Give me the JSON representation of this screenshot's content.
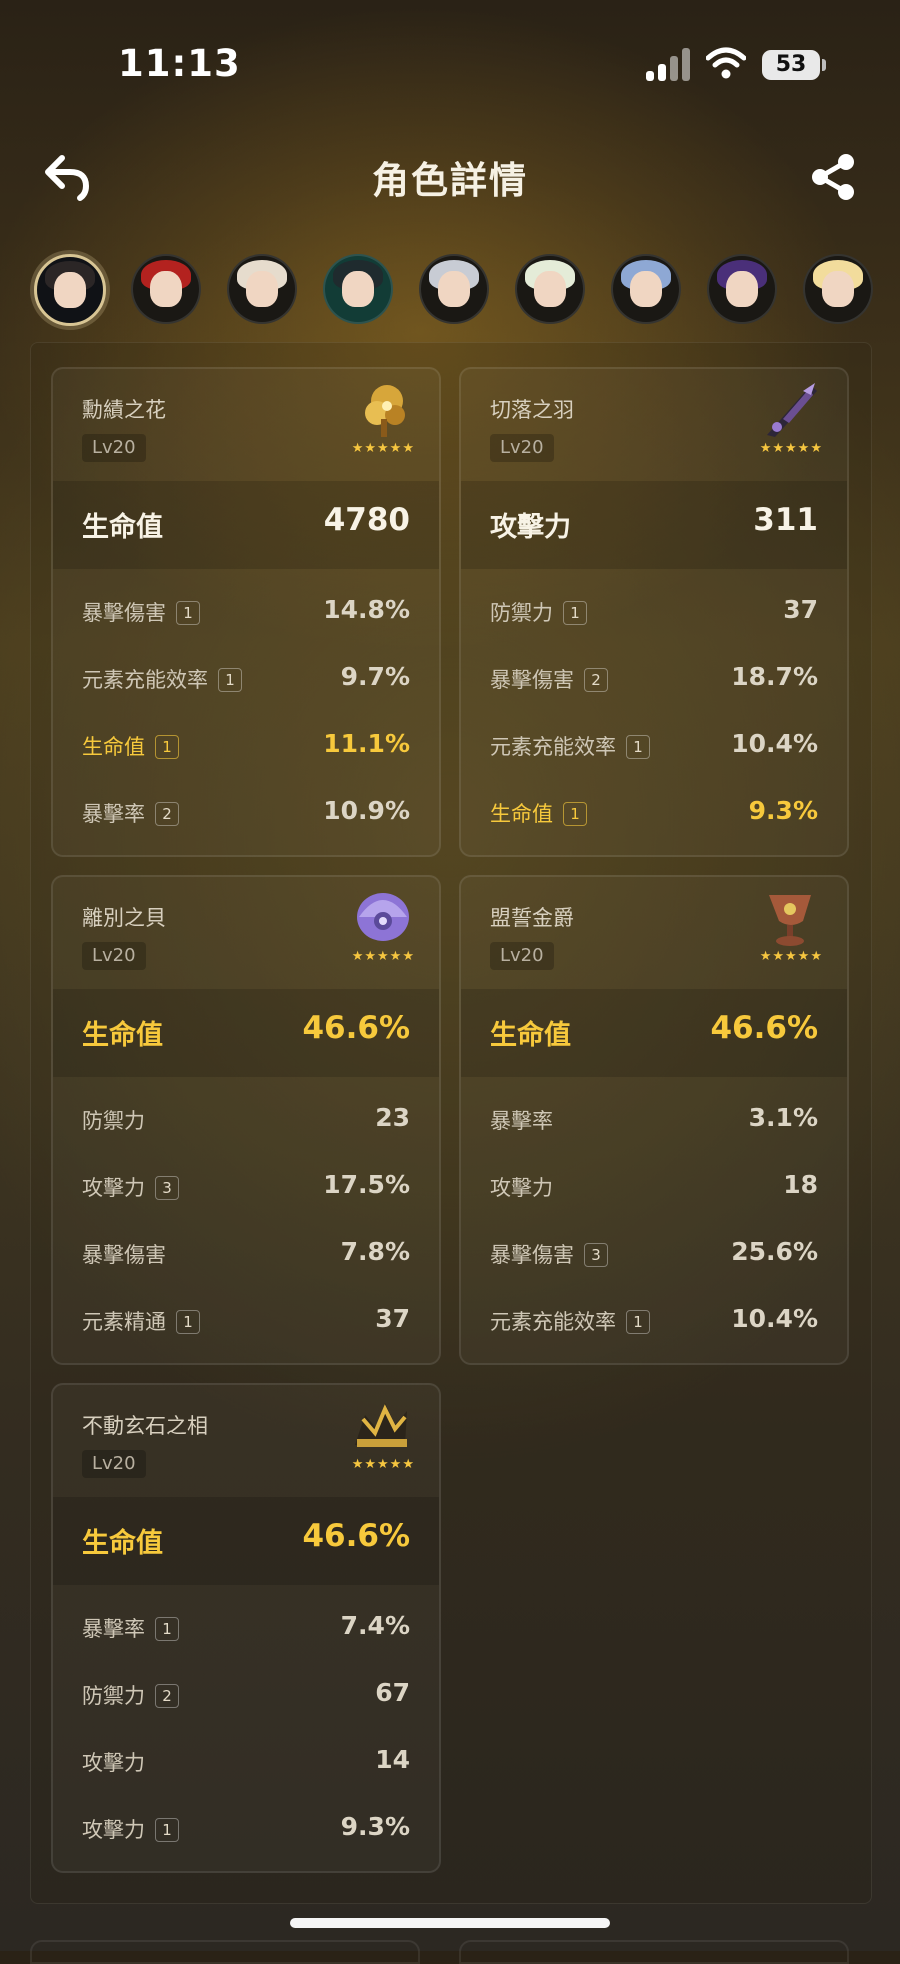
{
  "status": {
    "time": "11:13",
    "battery": "53"
  },
  "header": {
    "title": "角色詳情"
  },
  "colors": {
    "accent_gold": "#f7c93c",
    "star": "#f6c640"
  },
  "icons": [
    "back-arrow-icon",
    "share-icon",
    "signal-icon",
    "wifi-icon",
    "battery-icon"
  ],
  "avatars": [
    {
      "name": "character-1",
      "active": true
    },
    {
      "name": "character-2"
    },
    {
      "name": "character-3"
    },
    {
      "name": "character-4"
    },
    {
      "name": "character-5"
    },
    {
      "name": "character-6"
    },
    {
      "name": "character-7"
    },
    {
      "name": "character-8"
    },
    {
      "name": "character-9"
    }
  ],
  "artifacts": [
    {
      "name": "勳績之花",
      "level": "Lv20",
      "stars": "★★★★★",
      "main": {
        "label": "生命值",
        "value": "4780",
        "highlight": false
      },
      "subs": [
        {
          "label": "暴擊傷害",
          "rolls": "1",
          "value": "14.8%",
          "highlight": false
        },
        {
          "label": "元素充能效率",
          "rolls": "1",
          "value": "9.7%",
          "highlight": false
        },
        {
          "label": "生命值",
          "rolls": "1",
          "value": "11.1%",
          "highlight": true
        },
        {
          "label": "暴擊率",
          "rolls": "2",
          "value": "10.9%",
          "highlight": false
        }
      ]
    },
    {
      "name": "切落之羽",
      "level": "Lv20",
      "stars": "★★★★★",
      "main": {
        "label": "攻擊力",
        "value": "311",
        "highlight": false
      },
      "subs": [
        {
          "label": "防禦力",
          "rolls": "1",
          "value": "37",
          "highlight": false
        },
        {
          "label": "暴擊傷害",
          "rolls": "2",
          "value": "18.7%",
          "highlight": false
        },
        {
          "label": "元素充能效率",
          "rolls": "1",
          "value": "10.4%",
          "highlight": false
        },
        {
          "label": "生命值",
          "rolls": "1",
          "value": "9.3%",
          "highlight": true
        }
      ]
    },
    {
      "name": "離別之貝",
      "level": "Lv20",
      "stars": "★★★★★",
      "main": {
        "label": "生命值",
        "value": "46.6%",
        "highlight": true
      },
      "subs": [
        {
          "label": "防禦力",
          "rolls": "",
          "value": "23",
          "highlight": false
        },
        {
          "label": "攻擊力",
          "rolls": "3",
          "value": "17.5%",
          "highlight": false
        },
        {
          "label": "暴擊傷害",
          "rolls": "",
          "value": "7.8%",
          "highlight": false
        },
        {
          "label": "元素精通",
          "rolls": "1",
          "value": "37",
          "highlight": false
        }
      ]
    },
    {
      "name": "盟誓金爵",
      "level": "Lv20",
      "stars": "★★★★★",
      "main": {
        "label": "生命值",
        "value": "46.6%",
        "highlight": true
      },
      "subs": [
        {
          "label": "暴擊率",
          "rolls": "",
          "value": "3.1%",
          "highlight": false
        },
        {
          "label": "攻擊力",
          "rolls": "",
          "value": "18",
          "highlight": false
        },
        {
          "label": "暴擊傷害",
          "rolls": "3",
          "value": "25.6%",
          "highlight": false
        },
        {
          "label": "元素充能效率",
          "rolls": "1",
          "value": "10.4%",
          "highlight": false
        }
      ]
    },
    {
      "name": "不動玄石之相",
      "level": "Lv20",
      "stars": "★★★★★",
      "main": {
        "label": "生命值",
        "value": "46.6%",
        "highlight": true
      },
      "subs": [
        {
          "label": "暴擊率",
          "rolls": "1",
          "value": "7.4%",
          "highlight": false
        },
        {
          "label": "防禦力",
          "rolls": "2",
          "value": "67",
          "highlight": false
        },
        {
          "label": "攻擊力",
          "rolls": "",
          "value": "14",
          "highlight": false
        },
        {
          "label": "攻擊力",
          "rolls": "1",
          "value": "9.3%",
          "highlight": false
        }
      ]
    }
  ]
}
